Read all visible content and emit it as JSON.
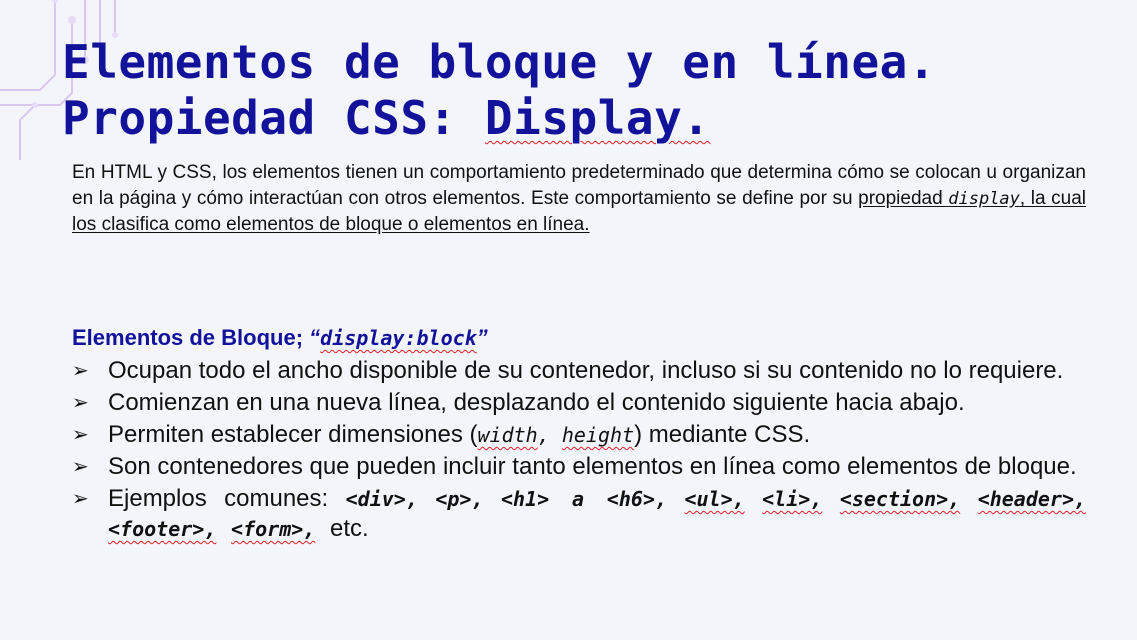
{
  "colors": {
    "title": "#12129a",
    "background": "#f4f5fb",
    "text": "#111111"
  },
  "title": {
    "line1": "Elementos de bloque y en línea.",
    "line2_prefix": "Propiedad CSS: ",
    "line2_word": "Display."
  },
  "intro": {
    "text_before": "En HTML y CSS, los elementos tienen un comportamiento predeterminado que determina cómo se colocan u organizan en la página y cómo interactúan con otros elementos. Este comportamiento se define por su ",
    "underlined_before": "propiedad ",
    "underlined_code": "display",
    "underlined_after": ", la cual los clasifica como elementos de bloque o elementos en línea."
  },
  "block_section": {
    "heading_text": "Elementos de Bloque; ",
    "heading_open_quote": "“",
    "heading_code": "display:block",
    "heading_close_quote": "”",
    "bullet_icon": "arrowhead-icon",
    "bullets": [
      {
        "text": "Ocupan todo el ancho disponible de su contenedor, incluso si su contenido no lo requiere."
      },
      {
        "text": "Comienzan en una nueva línea, desplazando el contenido siguiente hacia abajo."
      },
      {
        "before": "Permiten establecer dimensiones (",
        "code1": "width",
        "sep": ", ",
        "code2": "height",
        "after": ") mediante CSS."
      },
      {
        "text": "Son contenedores que pueden incluir tanto elementos en línea como elementos de bloque."
      },
      {
        "before": "Ejemplos comunes: ",
        "examples": [
          "<div>,",
          "<p>,",
          "<h1> a <h6>,",
          "<ul>,",
          "<li>,",
          "<section>,",
          "<header>,",
          "<footer>,",
          "<form>,"
        ],
        "after": " etc."
      }
    ]
  }
}
